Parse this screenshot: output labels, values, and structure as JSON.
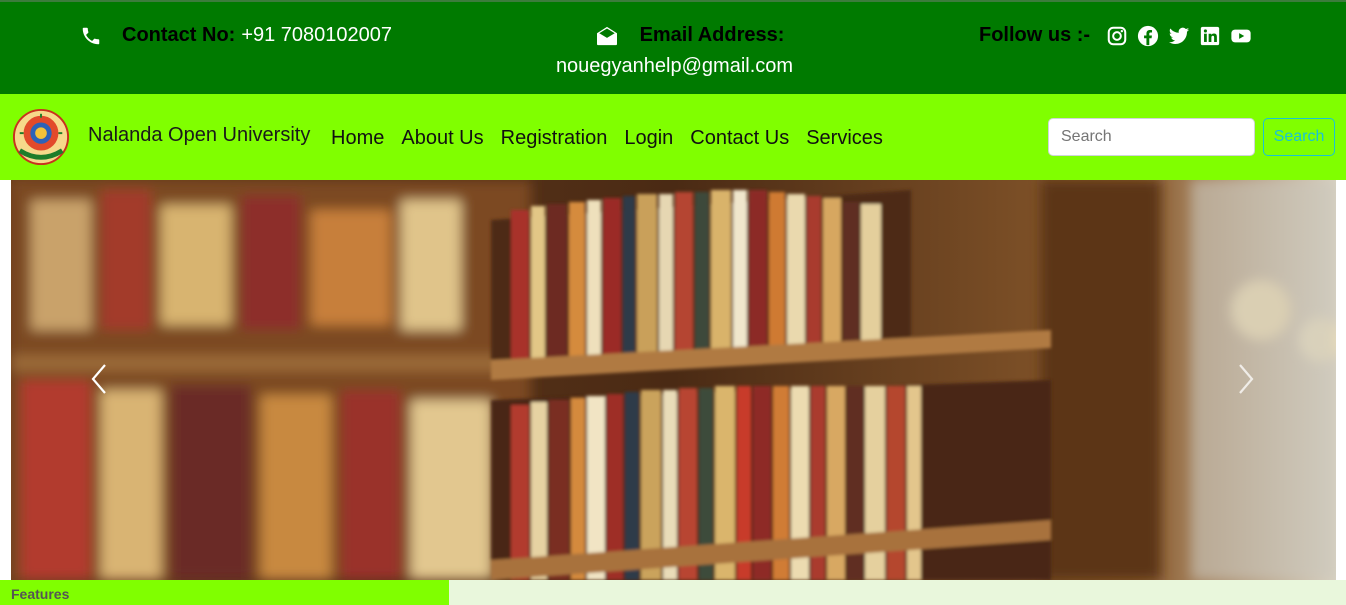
{
  "topbar": {
    "contact_label": "Contact No:",
    "contact_value": "+91 7080102007",
    "email_label": "Email Address:",
    "email_value": "nouegyanhelp@gmail.com",
    "follow_label": "Follow us :-",
    "social_icons": [
      "instagram-icon",
      "facebook-icon",
      "twitter-icon",
      "linkedin-icon",
      "youtube-icon"
    ],
    "background": "#007a00"
  },
  "navbar": {
    "brand": "Nalanda Open University",
    "items": [
      "Home",
      "About Us",
      "Registration",
      "Login",
      "Contact Us",
      "Services"
    ],
    "search_placeholder": "Search",
    "search_button": "Search",
    "background": "#80ff00"
  },
  "carousel": {
    "prev_icon": "chevron-left-icon",
    "next_icon": "chevron-right-icon"
  },
  "features": {
    "label": "Features"
  }
}
